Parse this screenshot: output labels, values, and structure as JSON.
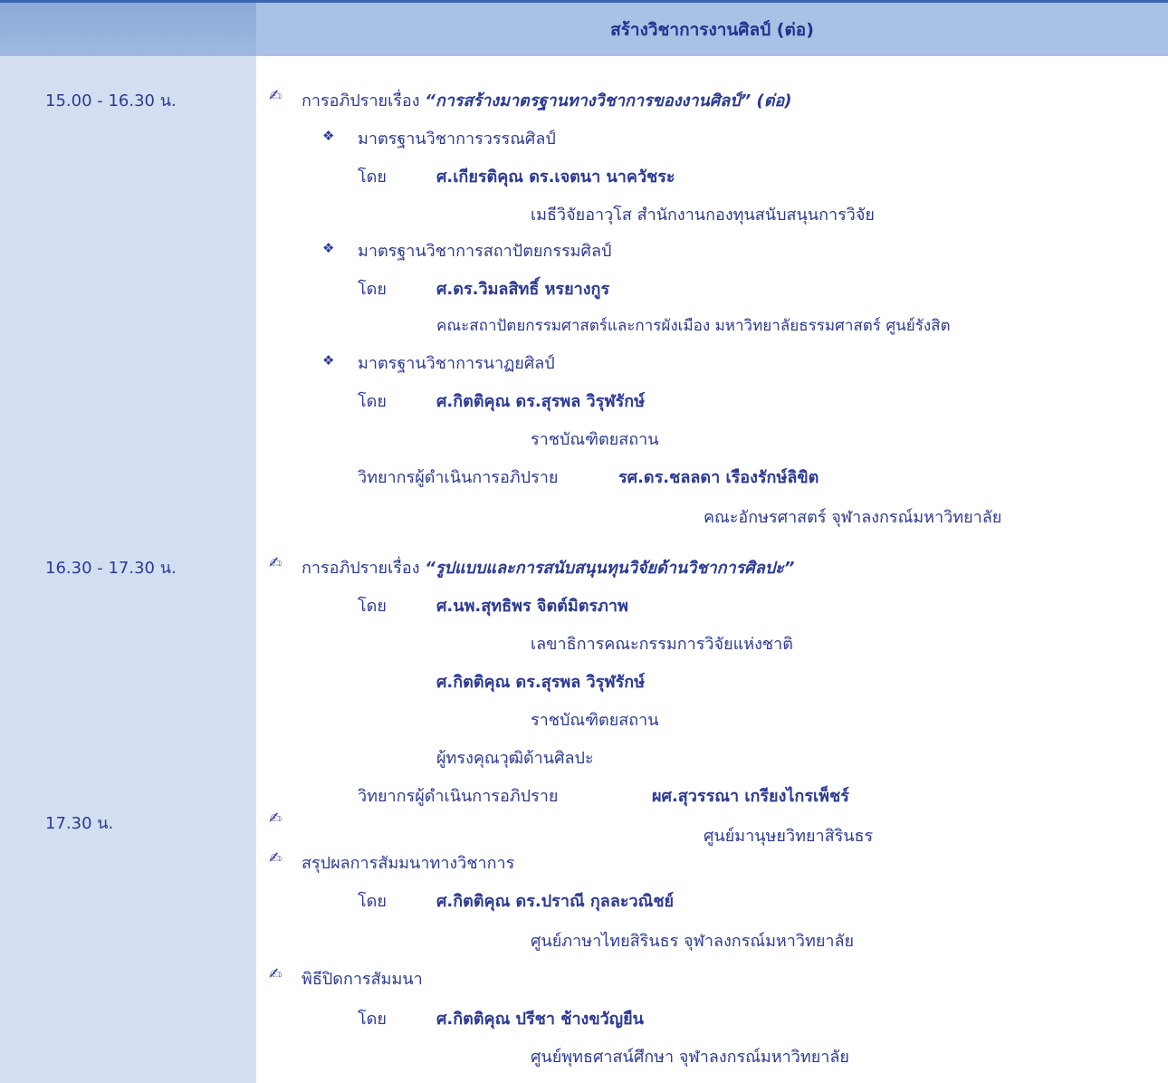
{
  "header": {
    "title": "สร้างวิชาการงานศิลป์ (ต่อ)"
  },
  "times": [
    "15.00 - 16.30 น.",
    "16.30 - 17.30 น.",
    "17.30 น."
  ],
  "s1": {
    "topic_prefix": "การอภิปรายเรื่อง",
    "topic_title": "“การสร้างมาตรฐานทางวิชาการของงานศิลป์” (ต่อ)",
    "by": "โดย",
    "items": [
      {
        "title": "มาตรฐานวิชาการวรรณศิลป์",
        "name": "ศ.เกียรติคุณ ดร.เจตนา  นาควัชระ",
        "aff": "เมธีวิจัยอาวุโส สำนักงานกองทุนสนับสนุนการวิจัย"
      },
      {
        "title": "มาตรฐานวิชาการสถาปัตยกรรมศิลป์",
        "name": "ศ.ดร.วิมลสิทธิ์  หรยางกูร",
        "aff": "คณะสถาปัตยกรรมศาสตร์และการผังเมือง มหาวิทยาลัยธรรมศาสตร์ ศูนย์รังสิต"
      },
      {
        "title": "มาตรฐานวิชาการนาฏยศิลป์",
        "name": "ศ.กิตติคุณ ดร.สุรพล  วิรุฬรักษ์",
        "aff": "ราชบัณฑิตยสถาน"
      }
    ],
    "moderator_label": "วิทยากรผู้ดำเนินการอภิปราย",
    "moderator_name": "รศ.ดร.ชลลดา  เรืองรักษ์ลิขิต",
    "moderator_aff": "คณะอักษรศาสตร์ จุฬาลงกรณ์มหาวิทยาลัย"
  },
  "s2": {
    "topic_prefix": "การอภิปรายเรื่อง",
    "topic_title": "“รูปแบบและการสนับสนุนทุนวิจัยด้านวิชาการศิลปะ”",
    "by": "โดย",
    "name1": "ศ.นพ.สุทธิพร  จิตต์มิตรภาพ",
    "aff1": "เลขาธิการคณะกรรมการวิจัยแห่งชาติ",
    "name2": "ศ.กิตติคุณ ดร.สุรพล  วิรุฬรักษ์",
    "aff2": "ราชบัณฑิตยสถาน",
    "name3": "ผู้ทรงคุณวุฒิด้านศิลปะ",
    "moderator_label": "วิทยากรผู้ดำเนินการอภิปราย",
    "moderator_name": "ผศ.สุวรรณา  เกรียงไกรเพ็ชร์",
    "moderator_aff": "ศูนย์มานุษยวิทยาสิรินธร"
  },
  "s3": {
    "summary": "สรุปผลการสัมมนาทางวิชาการ",
    "by": "โดย",
    "name1": "ศ.กิตติคุณ ดร.ปราณี  กุลละวณิชย์",
    "aff1": "ศูนย์ภาษาไทยสิรินธร  จุฬาลงกรณ์มหาวิทยาลัย",
    "closing": "พิธีปิดการสัมมนา",
    "name2": "ศ.กิตติคุณ ปรีชา  ช้างขวัญยืน",
    "aff2": "ศูนย์พุทธศาสน์ศึกษา  จุฬาลงกรณ์มหาวิทยาลัย"
  },
  "icons": {
    "pen": "writing-hand-icon",
    "bullet": "diamond-bullet-icon"
  },
  "colors": {
    "header": "#a9c1e5",
    "left_col": "#d3dff1",
    "text": "#2c3a95",
    "rule": "#3a66b0"
  }
}
